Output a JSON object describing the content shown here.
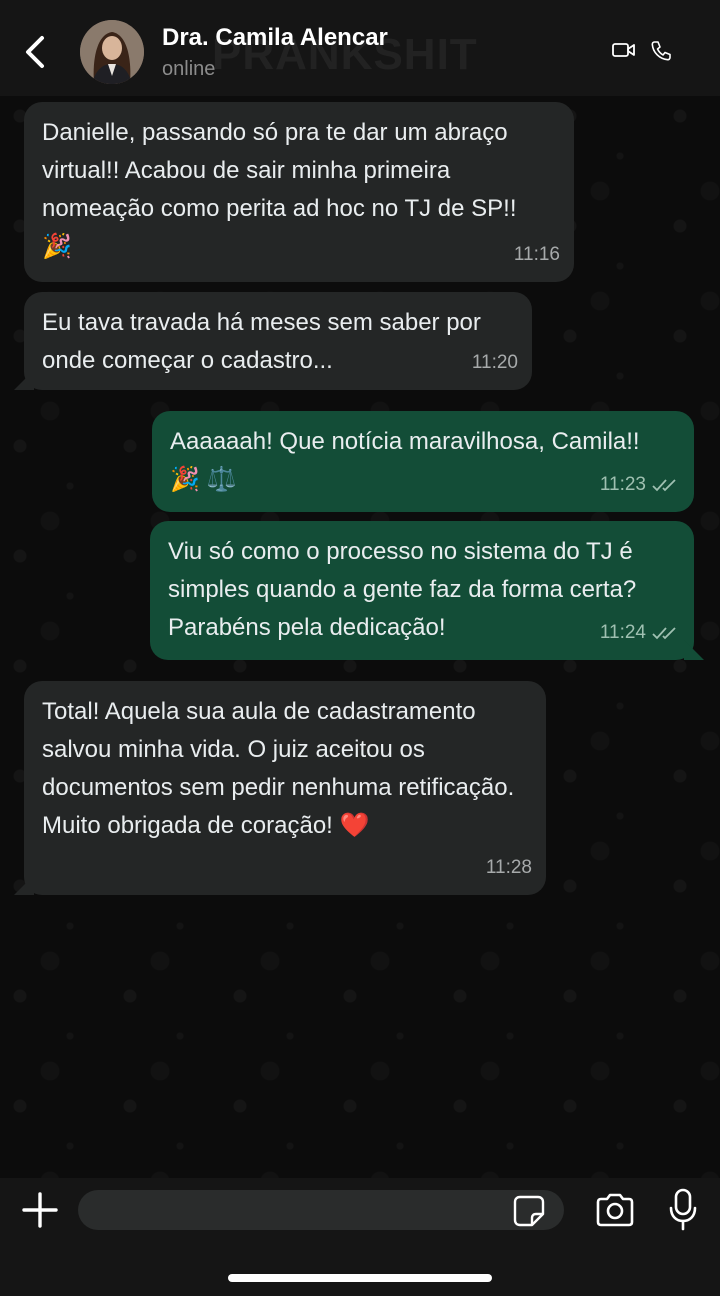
{
  "header": {
    "contact_name": "Dra. Camila Alencar",
    "status": "online"
  },
  "watermark": "PRANKSHIT",
  "messages": [
    {
      "direction": "in",
      "text": "Danielle, passando só pra te dar um abraço virtual!! Acabou de sair minha primeira nomeação como perita ad hoc no TJ de SP!!",
      "emoji": "🎉",
      "time": "11:16"
    },
    {
      "direction": "in",
      "text": "Eu tava travada há meses sem saber por onde começar o cadastro...",
      "time": "11:20"
    },
    {
      "direction": "out",
      "text": "Aaaaaah! Que notícia maravilhosa, Camila!!",
      "emoji": "🎉 ⚖️",
      "time": "11:23",
      "status": "read"
    },
    {
      "direction": "out",
      "text": "Viu só como o processo no sistema do TJ é simples quando a gente faz da forma certa? Parabéns pela dedicação!",
      "time": "11:24",
      "status": "read"
    },
    {
      "direction": "in",
      "text": "Total! Aquela sua aula de cadastramento salvou minha vida. O juiz aceitou os documentos sem pedir nenhuma retificação. Muito obrigada de coração! ❤️",
      "time": "11:28"
    }
  ],
  "input": {
    "placeholder": ""
  },
  "colors": {
    "incoming_bubble": "#242626",
    "outgoing_bubble": "#134d37",
    "header_bg": "#151515",
    "read_ticks": "#9fc0b1"
  },
  "icons": [
    "back-chevron-icon",
    "video-call-icon",
    "phone-icon",
    "plus-icon",
    "sticker-icon",
    "camera-icon",
    "microphone-icon",
    "double-check-icon"
  ]
}
